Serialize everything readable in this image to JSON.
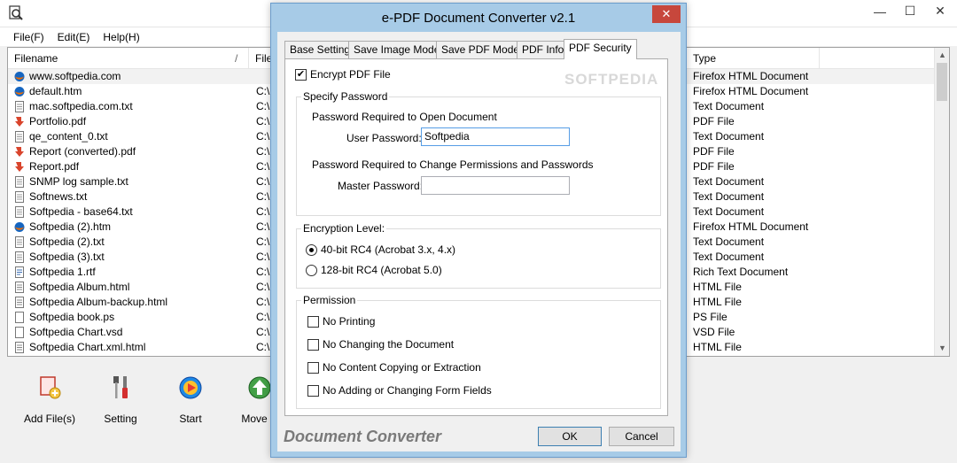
{
  "main": {
    "menu": [
      "File(F)",
      "Edit(E)",
      "Help(H)"
    ],
    "window_controls": {
      "minimize": "—",
      "maximize": "☐",
      "close": "✕"
    },
    "columns": {
      "filename": "Filename",
      "sort_mark": "/",
      "path": "File",
      "type": "Type"
    },
    "rows": [
      {
        "name": "www.softpedia.com",
        "path": "",
        "type": "Firefox HTML Document",
        "icon": "firefox-icon"
      },
      {
        "name": "default.htm",
        "path": "C:\\",
        "type": "Firefox HTML Document",
        "icon": "firefox-icon"
      },
      {
        "name": "mac.softpedia.com.txt",
        "path": "C:\\",
        "type": "Text Document",
        "icon": "text-file-icon"
      },
      {
        "name": "Portfolio.pdf",
        "path": "C:\\",
        "type": "PDF File",
        "icon": "pdf-icon"
      },
      {
        "name": "qe_content_0.txt",
        "path": "C:\\",
        "type": "Text Document",
        "icon": "text-file-icon"
      },
      {
        "name": "Report (converted).pdf",
        "path": "C:\\",
        "type": "PDF File",
        "icon": "pdf-icon"
      },
      {
        "name": "Report.pdf",
        "path": "C:\\",
        "type": "PDF File",
        "icon": "pdf-icon"
      },
      {
        "name": "SNMP log sample.txt",
        "path": "C:\\",
        "type": "Text Document",
        "icon": "text-file-icon"
      },
      {
        "name": "Softnews.txt",
        "path": "C:\\",
        "type": "Text Document",
        "icon": "text-file-icon"
      },
      {
        "name": "Softpedia - base64.txt",
        "path": "C:\\",
        "type": "Text Document",
        "icon": "text-file-icon"
      },
      {
        "name": "Softpedia (2).htm",
        "path": "C:\\",
        "type": "Firefox HTML Document",
        "icon": "firefox-icon"
      },
      {
        "name": "Softpedia (2).txt",
        "path": "C:\\",
        "type": "Text Document",
        "icon": "text-file-icon"
      },
      {
        "name": "Softpedia (3).txt",
        "path": "C:\\",
        "type": "Text Document",
        "icon": "text-file-icon"
      },
      {
        "name": "Softpedia 1.rtf",
        "path": "C:\\",
        "type": "Rich Text Document",
        "icon": "rtf-file-icon"
      },
      {
        "name": "Softpedia Album.html",
        "path": "C:\\",
        "type": "HTML File",
        "icon": "html-file-icon"
      },
      {
        "name": "Softpedia Album-backup.html",
        "path": "C:\\",
        "type": "HTML File",
        "icon": "html-file-icon"
      },
      {
        "name": "Softpedia book.ps",
        "path": "C:\\",
        "type": "PS File",
        "icon": "generic-file-icon"
      },
      {
        "name": "Softpedia Chart.vsd",
        "path": "C:\\",
        "type": "VSD File",
        "icon": "generic-file-icon"
      },
      {
        "name": "Softpedia Chart.xml.html",
        "path": "C:\\",
        "type": "HTML File",
        "icon": "html-file-icon"
      }
    ],
    "toolbar": [
      {
        "label": "Add File(s)",
        "icon": "add-files-icon"
      },
      {
        "label": "Setting",
        "icon": "tools-icon"
      },
      {
        "label": "Start",
        "icon": "start-icon"
      },
      {
        "label": "Move U",
        "icon": "move-up-icon"
      }
    ]
  },
  "dialog": {
    "title": "e-PDF Document Converter v2.1",
    "close_glyph": "✕",
    "tabs": [
      "Base Setting",
      "Save Image Mode",
      "Save PDF Mode",
      "PDF Info",
      "PDF Security"
    ],
    "active_tab": "PDF Security",
    "watermark": "SOFTPEDIA",
    "encrypt_label": "Encrypt PDF File",
    "encrypt_checked": true,
    "password_group": {
      "title": "Specify Password",
      "open_heading": "Password Required to Open Document",
      "user_label": "User Password:",
      "user_value": "Softpedia",
      "change_heading": "Password Required to Change Permissions and Passwords",
      "master_label": "Master Password:",
      "master_value": ""
    },
    "encryption_group": {
      "title": "Encryption Level:",
      "options": [
        "40-bit RC4 (Acrobat 3.x, 4.x)",
        "128-bit RC4 (Acrobat 5.0)"
      ],
      "selected": 0
    },
    "permission_group": {
      "title": "Permission",
      "options": [
        "No Printing",
        "No Changing the Document",
        "No Content Copying or Extraction",
        "No Adding or Changing Form Fields"
      ]
    },
    "footer_brand": "Document Converter",
    "ok_label": "OK",
    "cancel_label": "Cancel"
  },
  "colors": {
    "dialog_frame": "#a7cbe7",
    "close_button": "#c7473c",
    "pdf_red": "#d9442c"
  }
}
